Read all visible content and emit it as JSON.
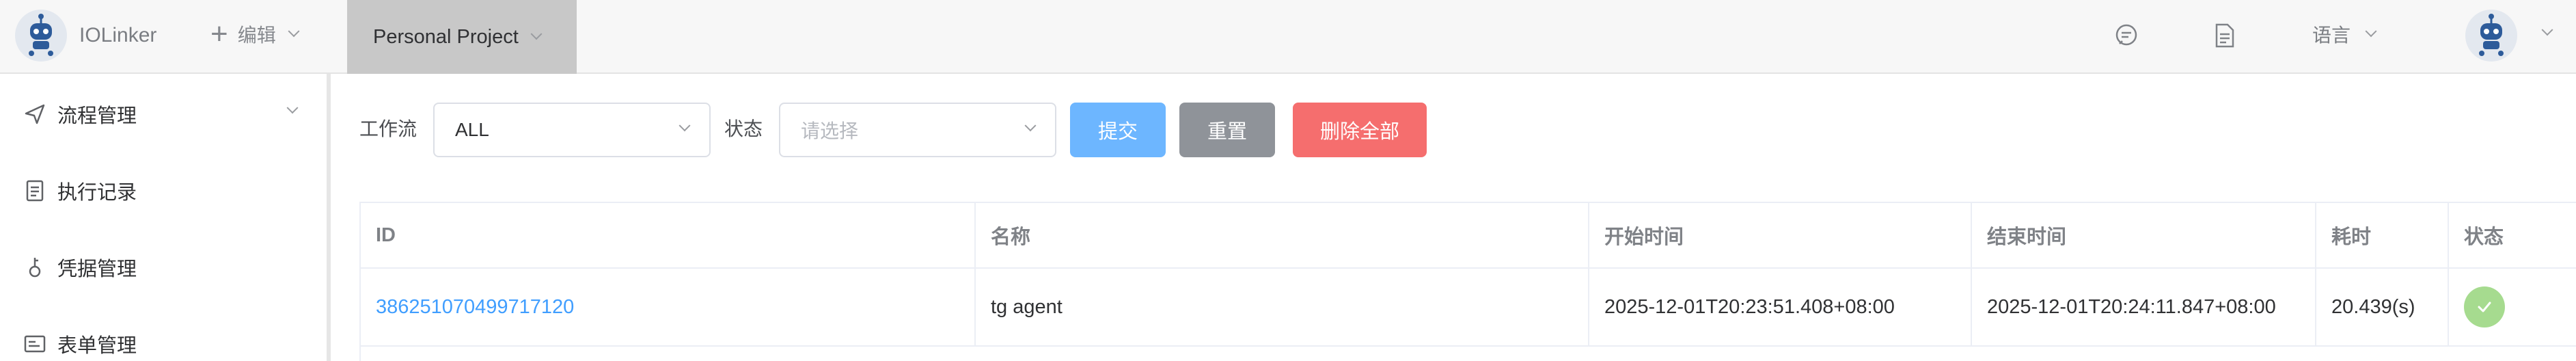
{
  "header": {
    "logo_text": "IOLinker",
    "edit_label": "编辑",
    "project_label": "Personal Project",
    "language_label": "语言"
  },
  "sidebar": {
    "items": [
      {
        "label": "流程管理",
        "icon": "send-icon"
      },
      {
        "label": "执行记录",
        "icon": "document-icon"
      },
      {
        "label": "凭据管理",
        "icon": "key-icon"
      },
      {
        "label": "表单管理",
        "icon": "form-icon"
      }
    ]
  },
  "filters": {
    "workflow_label": "工作流",
    "workflow_value": "ALL",
    "status_label": "状态",
    "status_placeholder": "请选择",
    "submit_label": "提交",
    "reset_label": "重置",
    "delete_all_label": "删除全部"
  },
  "table": {
    "columns": [
      "ID",
      "名称",
      "开始时间",
      "结束时间",
      "耗时",
      "状态"
    ],
    "rows": [
      {
        "id": "386251070499717120",
        "name": "tg agent",
        "start": "2025-12-01T20:23:51.408+08:00",
        "end": "2025-12-01T20:24:11.847+08:00",
        "duration": "20.439(s)",
        "status": "success"
      }
    ]
  },
  "colors": {
    "primary": "#409eff",
    "submit": "#6db6ff",
    "reset": "#8f9399",
    "danger": "#f56e6e",
    "success": "#a6db8f"
  }
}
